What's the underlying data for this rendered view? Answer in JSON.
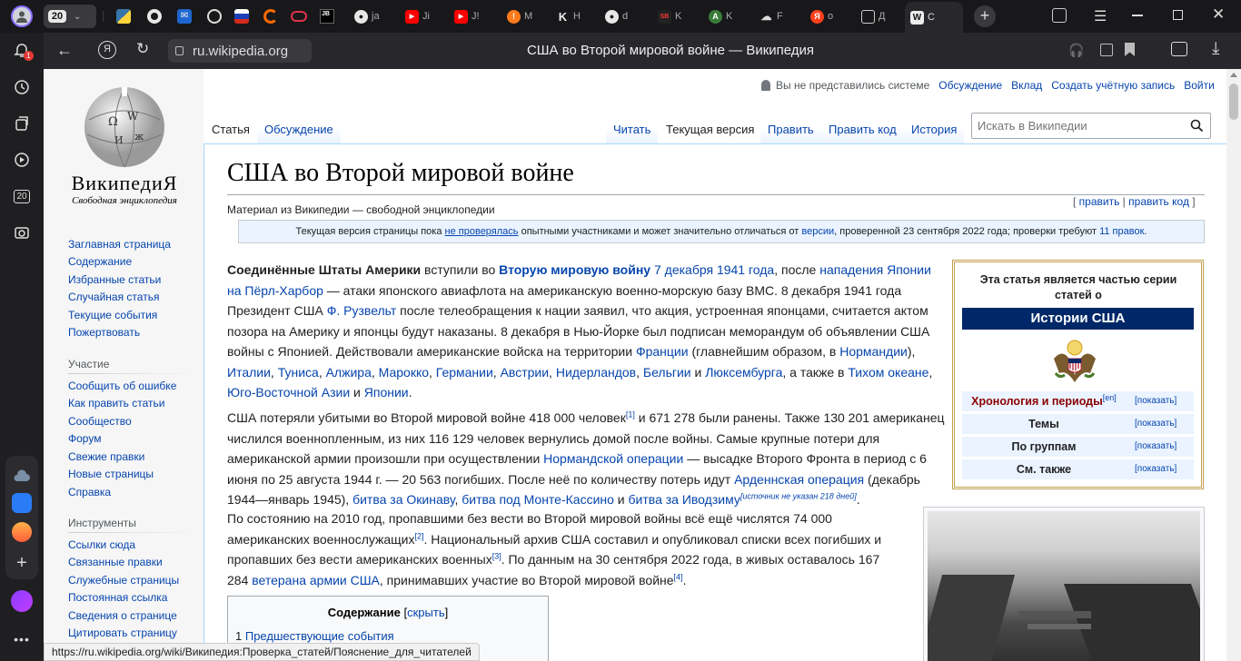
{
  "browser": {
    "tab_count": "20",
    "tabs": [
      {
        "label": "J",
        "icon": "jetbrains-icon"
      },
      {
        "label": "ja",
        "icon": "github-icon"
      },
      {
        "label": "Ji",
        "icon": "youtube-icon"
      },
      {
        "label": "J!",
        "icon": "youtube-icon"
      },
      {
        "label": "M",
        "icon": "page-icon"
      },
      {
        "label": "H",
        "icon": "k-icon"
      },
      {
        "label": "d",
        "icon": "github-icon"
      },
      {
        "label": "K",
        "icon": "sb-icon"
      },
      {
        "label": "K",
        "icon": "a-icon"
      },
      {
        "label": "F",
        "icon": "cloud-icon"
      },
      {
        "label": "o",
        "icon": "yandex-icon"
      },
      {
        "label": "Д",
        "icon": "window-icon"
      },
      {
        "label": "С",
        "icon": "wikipedia-icon"
      }
    ],
    "address": "ru.wikipedia.org",
    "page_title": "США во Второй мировой войне — Википедия",
    "notification_count": "1",
    "sidebar_tab_count": "20",
    "status_url": "https://ru.wikipedia.org/wiki/Википедия:Проверка_статей/Пояснение_для_читателей"
  },
  "wiki": {
    "logo_title": "ВикипедиЯ",
    "logo_subtitle": "Свободная энциклопедия",
    "personal": {
      "not_logged": "Вы не представились системе",
      "discussion": "Обсуждение",
      "contrib": "Вклад",
      "create": "Создать учётную запись",
      "login": "Войти"
    },
    "tabs_left": [
      "Статья",
      "Обсуждение"
    ],
    "tabs_right": [
      "Читать",
      "Текущая версия",
      "Править",
      "Править код",
      "История"
    ],
    "search_placeholder": "Искать в Википедии",
    "nav": [
      "Заглавная страница",
      "Содержание",
      "Избранные статьи",
      "Случайная статья",
      "Текущие события",
      "Пожертвовать"
    ],
    "participation_head": "Участие",
    "participation": [
      "Сообщить об ошибке",
      "Как править статьи",
      "Сообщество",
      "Форум",
      "Свежие правки",
      "Новые страницы",
      "Справка"
    ],
    "tools_head": "Инструменты",
    "tools": [
      "Ссылки сюда",
      "Связанные правки",
      "Служебные страницы",
      "Постоянная ссылка",
      "Сведения о странице",
      "Цитировать страницу"
    ],
    "title": "США во Второй мировой войне",
    "tagline": "Материал из Википедии — свободной энциклопедии",
    "edit_links": {
      "open": "[ ",
      "edit": "править",
      "sep": " | ",
      "edit_code": "править код",
      "close": " ]"
    },
    "notice": {
      "p1": "Текущая версия страницы пока ",
      "l1": "не проверялась",
      "p2": " опытными участниками и может значительно отличаться от ",
      "l2": "версии",
      "p3": ", проверенной 23 сентября 2022 года; проверки требуют ",
      "l3": "11 правок",
      "p4": "."
    },
    "toc": {
      "title": "Содержание",
      "hide": "скрыть",
      "item1_num": "1",
      "item1": "Предшествующие события"
    },
    "infobox": {
      "head": "Эта статья является частью серии статей о",
      "series": "Истории США",
      "rows": [
        {
          "label": "Хронология и периоды",
          "sup": "[en]",
          "action": "[показать]"
        },
        {
          "label": "Темы",
          "sup": "",
          "action": "[показать]"
        },
        {
          "label": "По группам",
          "sup": "",
          "action": "[показать]"
        },
        {
          "label": "См. также",
          "sup": "",
          "action": "[показать]"
        }
      ]
    }
  },
  "para1": {
    "b1": "Соединённые Штаты Америки",
    "t1": " вступили во ",
    "a1": "Вторую мировую войну",
    "t2": " ",
    "a2": "7 декабря 1941 года",
    "t3": ", после ",
    "a3": "нападения Японии на Пёрл-Харбор",
    "t4": " — атаки японского авиафлота на американскую военно-морскую базу ВМС. 8 декабря 1941 года Президент США ",
    "a4": "Ф. Рузвельт",
    "t5": " после телеобращения к нации заявил, что акция, устроенная японцами, считается актом позора на Америку и японцы будут наказаны. 8 декабря в Нью-Йорке был подписан меморандум об объявлении США войны с Японией. Действовали американские войска на территории ",
    "a5": "Франции",
    "t6": " (главнейшим образом, в ",
    "a6": "Нормандии",
    "t7": "), ",
    "a7": "Италии",
    "t8": ", ",
    "a8": "Туниса",
    "t9": ", ",
    "a9": "Алжира",
    "t10": ", ",
    "a10": "Марокко",
    "t11": ", ",
    "a11": "Германии",
    "t12": ", ",
    "a12": "Австрии",
    "t13": ", ",
    "a13": "Нидерландов",
    "t14": ", ",
    "a14": "Бельгии",
    "t15": " и ",
    "a15": "Люксембурга",
    "t16": ", а также в ",
    "a16": "Тихом океане",
    "t17": ", ",
    "a17": "Юго-Восточной Азии",
    "t18": " и ",
    "a18": "Японии",
    "t19": "."
  },
  "para2": {
    "t1": "США потеряли убитыми во Второй мировой войне 418 000 человек",
    "s1": "[1]",
    "t2": " и 671 278 были ранены. Также 130 201 американец числился военнопленным, из них 116 129 человек вернулись домой после войны. Самые крупные потери для американской армии произошли при осуществлении ",
    "a1": "Нормандской операции",
    "t3": " — высадке Второго Фронта в период с 6 июня по 25 августа 1944 г. — 20 563 погибших. После неё по количеству потерь идут ",
    "a2": "Арденнская операция",
    "t4": " (декабрь 1944—январь 1945), ",
    "a3": "битва за Окинаву",
    "t5": ", ",
    "a4": "битва под Монте-Кассино",
    "t6": " и ",
    "a5": "битва за Иводзиму",
    "s2": "[источник не указан 218 дней]",
    "t7": "."
  },
  "para3": {
    "t1": "По состоянию на 2010 год, пропавшими без вести во Второй мировой войны всё ещё числятся 74 000 американских военнослужащих",
    "s1": "[2]",
    "t2": ". Национальный архив США составил и опубликовал списки всех погибших и пропавших без вести американских военных",
    "s2": "[3]",
    "t3": ". По данным на 30 сентября 2022 года, в живых оставалось 167 284 ",
    "a1": "ветерана армии США",
    "t4": ", принимавших участие во Второй мировой войне",
    "s3": "[4]",
    "t5": "."
  }
}
